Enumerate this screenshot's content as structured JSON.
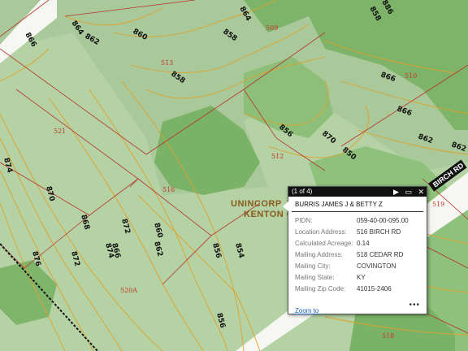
{
  "map": {
    "contour_labels": [
      "864",
      "864",
      "858",
      "862",
      "866",
      "866",
      "866",
      "870",
      "872",
      "874",
      "876",
      "886",
      "860",
      "858",
      "856",
      "850",
      "862",
      "868",
      "860",
      "862",
      "856",
      "854",
      "856",
      "870",
      "872",
      "874",
      "866",
      "858",
      "862"
    ],
    "lot_labels": [
      "509",
      "513",
      "510",
      "521",
      "512",
      "516",
      "520A",
      "518",
      "519"
    ],
    "area_label_line1": "UNINCORP",
    "area_label_line2": "KENTON C",
    "road_label": "BIRCH RD"
  },
  "popup": {
    "counter": "(1 of 4)",
    "title": "BURRIS JAMES J & BETTY Z",
    "fields": [
      {
        "label": "PIDN:",
        "value": "059-40-00-095.00"
      },
      {
        "label": "Location Address:",
        "value": "516 BIRCH RD"
      },
      {
        "label": "Calculated Acreage:",
        "value": "0.14"
      },
      {
        "label": "Mailing Address:",
        "value": "518 CEDAR RD"
      },
      {
        "label": "Mailing City:",
        "value": "COVINGTON"
      },
      {
        "label": "Mailing State:",
        "value": "KY"
      },
      {
        "label": "Mailing Zip Code:",
        "value": "41015-2406"
      }
    ],
    "zoom_link": "Zoom to",
    "more": "•••",
    "next_icon": "▶",
    "maximize_icon": "▭",
    "close_icon": "✕"
  }
}
